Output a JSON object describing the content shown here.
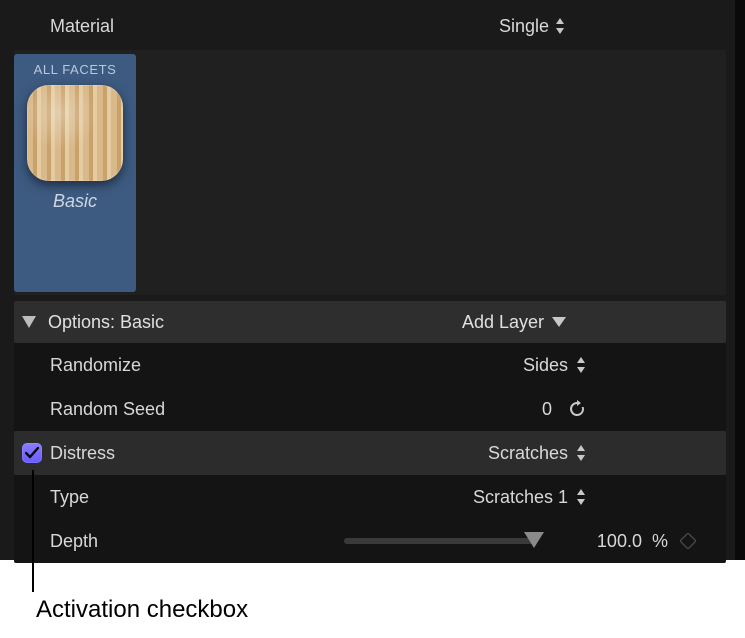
{
  "header": {
    "material_label": "Material",
    "material_value": "Single"
  },
  "facets": {
    "tab_label": "ALL FACETS",
    "name": "Basic"
  },
  "options": {
    "label": "Options: Basic",
    "add_layer_label": "Add Layer"
  },
  "params": {
    "randomize": {
      "label": "Randomize",
      "value": "Sides"
    },
    "random_seed": {
      "label": "Random Seed",
      "value": "0"
    },
    "distress": {
      "label": "Distress",
      "value": "Scratches",
      "checked": true
    },
    "type": {
      "label": "Type",
      "value": "Scratches 1"
    },
    "depth": {
      "label": "Depth",
      "value": "100.0",
      "unit": "%",
      "slider_pct": 100
    }
  },
  "annotation": {
    "label": "Activation checkbox"
  },
  "icons": {
    "stepper": "updown-stepper-icon",
    "disclosure": "disclosure-triangle-icon",
    "chevron_down": "chevron-down-icon",
    "refresh": "refresh-icon",
    "check": "check-icon",
    "keyframe": "keyframe-diamond-icon"
  },
  "colors": {
    "panel_bg": "#1a1a1a",
    "tile_bg": "#3d5a80",
    "row_highlight": "#2c2c2c",
    "checkbox_accent": "#7a6cff"
  }
}
